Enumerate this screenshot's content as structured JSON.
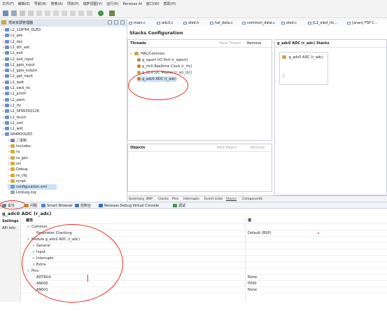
{
  "menu": [
    "文件(F)",
    "编辑(E)",
    "导航(N)",
    "搜索(A)",
    "项目(P)",
    "瑞萨视图(V)",
    "运行(R)",
    "Renesas AI",
    "窗口(W)",
    "帮助(H)"
  ],
  "left_panel": {
    "title": "项目资源管理器",
    "tree": [
      {
        "label": "L1_128*64_OLED",
        "level": 0,
        "kind": "project",
        "expanded": false
      },
      {
        "label": "L1_adc",
        "level": 0,
        "kind": "project",
        "expanded": false
      },
      {
        "label": "L1_dac",
        "level": 0,
        "kind": "project",
        "expanded": false
      },
      {
        "label": "L1_dtc_adc",
        "level": 0,
        "kind": "project",
        "expanded": false
      },
      {
        "label": "L1_exit",
        "level": 0,
        "kind": "project",
        "expanded": false
      },
      {
        "label": "L1_exit_input",
        "level": 0,
        "kind": "project",
        "expanded": false
      },
      {
        "label": "L1_gpio_input",
        "level": 0,
        "kind": "project",
        "expanded": false
      },
      {
        "label": "L1_gpio_output",
        "level": 0,
        "kind": "project",
        "expanded": false
      },
      {
        "label": "L1_gpt_input",
        "level": 0,
        "kind": "project",
        "expanded": false
      },
      {
        "label": "L1_iwdt",
        "level": 0,
        "kind": "project",
        "expanded": false
      },
      {
        "label": "L1_oled_rtc",
        "level": 0,
        "kind": "project",
        "expanded": false
      },
      {
        "label": "L1_printf",
        "level": 0,
        "kind": "project",
        "expanded": false
      },
      {
        "label": "L1_pwm",
        "level": 0,
        "kind": "project",
        "expanded": false
      },
      {
        "label": "L1_rtc",
        "level": 0,
        "kind": "project",
        "expanded": false
      },
      {
        "label": "L1_SPIW25Q128",
        "level": 0,
        "kind": "project",
        "expanded": false
      },
      {
        "label": "L1_touch",
        "level": 0,
        "kind": "project",
        "expanded": false
      },
      {
        "label": "L1_usrt",
        "level": 0,
        "kind": "project",
        "expanded": false
      },
      {
        "label": "L1_wdt",
        "level": 0,
        "kind": "project",
        "expanded": false
      },
      {
        "label": "RA4M2OLED",
        "level": 0,
        "kind": "project",
        "expanded": true
      },
      {
        "label": "二进制",
        "level": 1,
        "kind": "binary",
        "expanded": false
      },
      {
        "label": "Includes",
        "level": 1,
        "kind": "folder",
        "expanded": false
      },
      {
        "label": "ra",
        "level": 1,
        "kind": "folder",
        "expanded": false
      },
      {
        "label": "ra_gen",
        "level": 1,
        "kind": "folder",
        "expanded": false
      },
      {
        "label": "src",
        "level": 1,
        "kind": "folder",
        "expanded": false
      },
      {
        "label": "Debug",
        "level": 1,
        "kind": "folder",
        "expanded": false
      },
      {
        "label": "ra_cfg",
        "level": 1,
        "kind": "folder",
        "expanded": false
      },
      {
        "label": "script",
        "level": 1,
        "kind": "folder",
        "expanded": false
      },
      {
        "label": "configuration.xml",
        "level": 1,
        "kind": "config",
        "expanded": false
      },
      {
        "label": "LinkLog.log",
        "level": 1,
        "kind": "file",
        "expanded": false
      }
    ]
  },
  "editor_tabs": [
    {
      "label": "main.c",
      "active": false
    },
    {
      "label": "adc0.c",
      "active": false
    },
    {
      "label": "oled.h",
      "active": false
    },
    {
      "label": "hal_data.c",
      "active": false
    },
    {
      "label": "common_data.c",
      "active": false
    },
    {
      "label": "oled.c",
      "active": false
    },
    {
      "label": "[L1_oled_rtc...",
      "active": false
    },
    {
      "label": "[anan] FSP C...",
      "active": true
    }
  ],
  "stacks": {
    "title": "Stacks Configuration",
    "threads": {
      "header": "Threads",
      "new_thread": "New Thread",
      "remove": "Remove",
      "root": "HAL/Common",
      "items": [
        "g_ioport I/O Port (r_ioport)",
        "g_rtc0 Realtime Clock (r_rtc)",
        "g_i2c0 I2C Master (r_sci_i2c)",
        "g_adc0 ADC (r_adc)"
      ]
    },
    "stack_panel": {
      "header": "g_adc0 ADC (r_adc) Stacks",
      "box_label": "g_adc0 ADC (r_adc)",
      "info_symbol": "ⓘ"
    },
    "objects": {
      "header": "Objects",
      "new_object": "New Object",
      "remove": "Remove"
    },
    "bottom_tabs": [
      "Summary",
      "BSP",
      "Clocks",
      "Pins",
      "Interrupts",
      "Event Links",
      "Stacks",
      "Components"
    ]
  },
  "view_tabs": [
    {
      "label": "属性",
      "active": true
    },
    {
      "label": "问题",
      "active": false
    },
    {
      "label": "Smart Browser",
      "active": false
    },
    {
      "label": "控制台",
      "active": false
    },
    {
      "label": "Renesas Debug Virtual Console",
      "active": false
    },
    {
      "label": "调试",
      "active": false
    }
  ],
  "properties": {
    "title": "g_adc0 ADC (r_adc)",
    "side_tabs": [
      "Settings",
      "API Info"
    ],
    "col_property": "属性",
    "col_value": "值",
    "rows": [
      {
        "label": "Common",
        "value": "",
        "level": 0,
        "expander": "v"
      },
      {
        "label": "Parameter Checking",
        "value": "Default (BSP)",
        "level": 1,
        "expander": ""
      },
      {
        "label": "Module g_adc0 ADC (r_adc)",
        "value": "",
        "level": 0,
        "expander": "v"
      },
      {
        "label": "General",
        "value": "",
        "level": 1,
        "expander": ">"
      },
      {
        "label": "Input",
        "value": "",
        "level": 1,
        "expander": ">"
      },
      {
        "label": "Interrupts",
        "value": "",
        "level": 1,
        "expander": ">"
      },
      {
        "label": "Extra",
        "value": "",
        "level": 1,
        "expander": ">"
      },
      {
        "label": "Pins",
        "value": "",
        "level": 0,
        "expander": "v"
      },
      {
        "label": "ADTRG0",
        "value": "None",
        "level": 1,
        "expander": ""
      },
      {
        "label": "AN000",
        "value": "P000",
        "level": 1,
        "expander": ""
      },
      {
        "label": "AN001",
        "value": "None",
        "level": 1,
        "expander": ""
      }
    ]
  },
  "colors": {
    "annotation_red": "#e0301e",
    "selection_blue": "#cde3f7",
    "header_blue": "#dfe7f2"
  }
}
